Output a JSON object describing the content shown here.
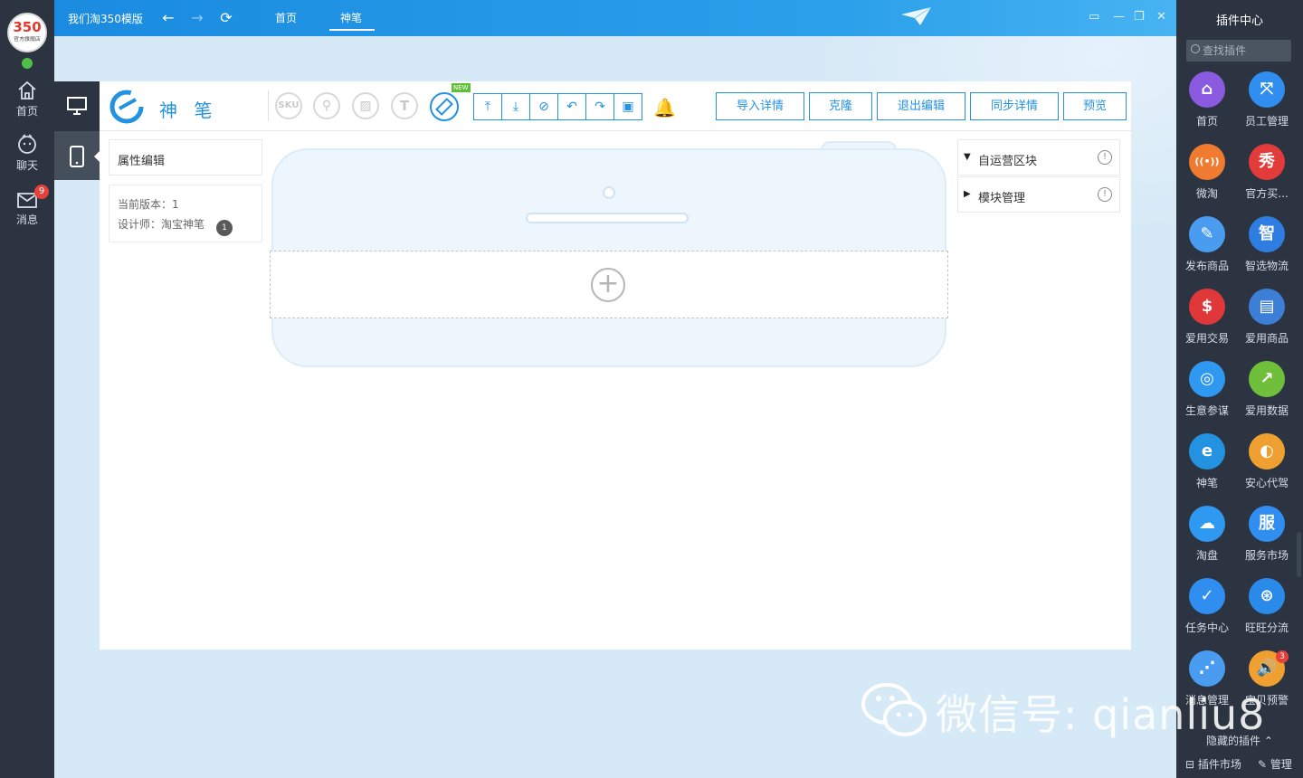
{
  "sidebar_left": {
    "logo_number": "350",
    "logo_sub": "官方旗舰店",
    "items": [
      {
        "label": "首页",
        "icon": "home-icon"
      },
      {
        "label": "聊天",
        "icon": "chat-icon"
      },
      {
        "label": "消息",
        "icon": "mail-icon",
        "badge": "9"
      }
    ]
  },
  "topbar": {
    "title": "我们淘350模版",
    "tabs": [
      {
        "label": "首页"
      },
      {
        "label": "神笔"
      }
    ],
    "active_tab": "神笔"
  },
  "toolbar": {
    "brand": "神 笔",
    "circle_tools": [
      "SKU",
      "link",
      "image",
      "T"
    ],
    "ruler_new_tag": "NEW",
    "buttons": [
      "导入详情",
      "克隆",
      "退出编辑",
      "同步详情",
      "预览"
    ]
  },
  "left_panel": {
    "title": "属性编辑",
    "version_text": "当前版本：1",
    "designer_text": "设计师：淘宝神笔",
    "designer_dot": "1"
  },
  "right_panel": {
    "items": [
      {
        "label": "自运营区块",
        "arrow": "▼"
      },
      {
        "label": "模块管理",
        "arrow": "▶"
      }
    ]
  },
  "plugin_center": {
    "title": "插件中心",
    "search_placeholder": "查找插件",
    "plugins": [
      {
        "label": "首页",
        "color": "#8a5be0",
        "glyph": "⌂"
      },
      {
        "label": "员工管理",
        "color": "#2f8ef0",
        "glyph": "⤧"
      },
      {
        "label": "微淘",
        "color": "#f07a30",
        "glyph": "((•))"
      },
      {
        "label": "官方买...",
        "color": "#e33a3a",
        "glyph": "秀"
      },
      {
        "label": "发布商品",
        "color": "#4a9cf0",
        "glyph": "✎"
      },
      {
        "label": "智选物流",
        "color": "#2f7de0",
        "glyph": "智"
      },
      {
        "label": "爱用交易",
        "color": "#e0383a",
        "glyph": "$"
      },
      {
        "label": "爱用商品",
        "color": "#3d7fd6",
        "glyph": "▤"
      },
      {
        "label": "生意参谋",
        "color": "#2f98f0",
        "glyph": "◎"
      },
      {
        "label": "爱用数据",
        "color": "#6fbf3a",
        "glyph": "↗"
      },
      {
        "label": "神笔",
        "color": "#2392e0",
        "glyph": "e"
      },
      {
        "label": "安心代驾",
        "color": "#f0a030",
        "glyph": "◐"
      },
      {
        "label": "淘盘",
        "color": "#2f98f0",
        "glyph": "☁"
      },
      {
        "label": "服务市场",
        "color": "#2f8ef0",
        "glyph": "服"
      },
      {
        "label": "任务中心",
        "color": "#2f8ef0",
        "glyph": "✓"
      },
      {
        "label": "旺旺分流",
        "color": "#2a8ae8",
        "glyph": "⊛"
      },
      {
        "label": "消息管理",
        "color": "#4a9cf0",
        "glyph": "⋰"
      },
      {
        "label": "宝贝预警",
        "color": "#f0a030",
        "glyph": "🔊",
        "badge": "3"
      }
    ],
    "hidden_plugins": "隐藏的插件",
    "market": "插件市场",
    "manage": "管理"
  },
  "watermark": "微信号: qianliu8"
}
